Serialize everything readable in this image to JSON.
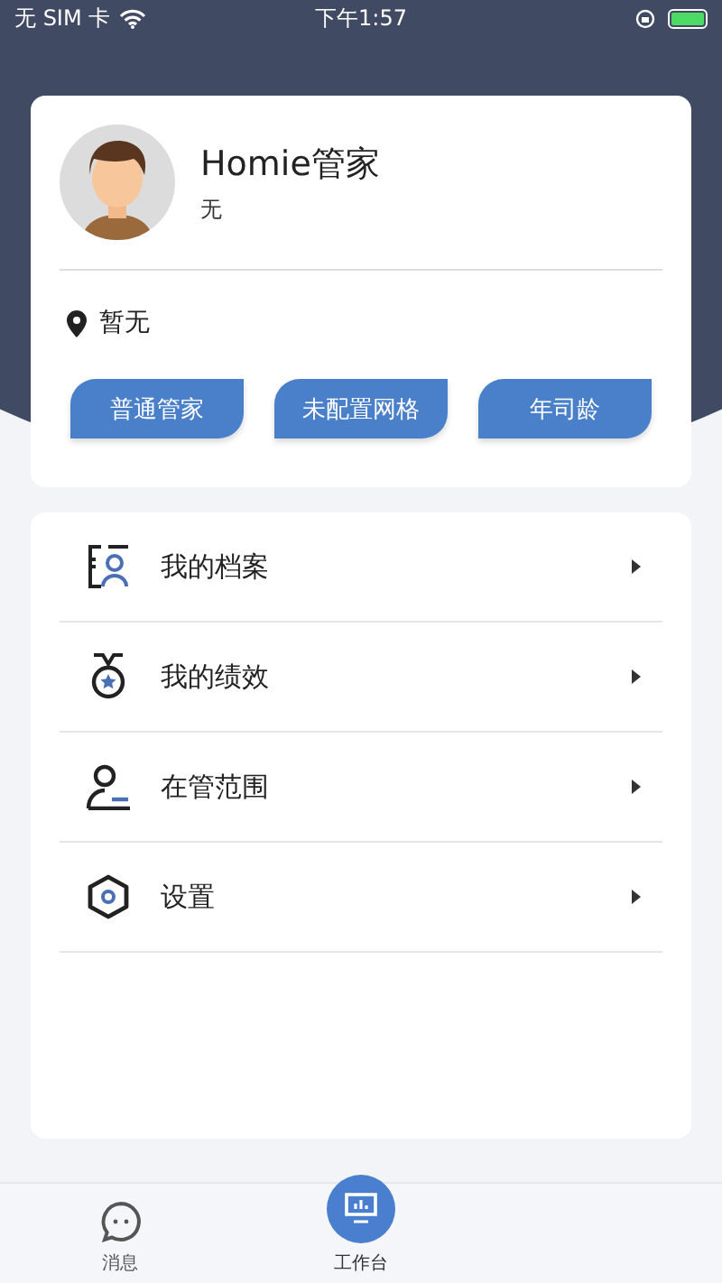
{
  "status_bar": {
    "carrier": "无 SIM 卡",
    "time": "下午1:57",
    "battery_charging": true
  },
  "profile": {
    "name": "Homie管家",
    "subtitle": "无",
    "location": "暂无",
    "tags": [
      "普通管家",
      "未配置网格",
      "年司龄"
    ]
  },
  "menu": [
    {
      "kind": "profile",
      "label": "我的档案"
    },
    {
      "kind": "medal",
      "label": "我的绩效"
    },
    {
      "kind": "scope",
      "label": "在管范围"
    },
    {
      "kind": "settings",
      "label": "设置"
    }
  ],
  "tab_bar": [
    {
      "kind": "message",
      "label": "消息",
      "selected": false
    },
    {
      "kind": "workbench",
      "label": "工作台",
      "selected": true
    }
  ]
}
